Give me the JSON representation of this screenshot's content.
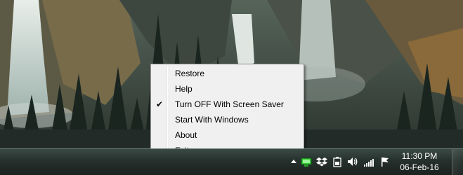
{
  "menu": {
    "items": [
      {
        "label": "Restore",
        "checked": false
      },
      {
        "label": "Help",
        "checked": false
      },
      {
        "label": "Turn OFF With Screen Saver",
        "checked": true
      },
      {
        "label": "Start With Windows",
        "checked": false
      },
      {
        "label": "About",
        "checked": false
      },
      {
        "label": "Exit",
        "checked": false
      }
    ],
    "check_glyph": "✔"
  },
  "taskbar": {
    "clock": {
      "time": "11:30 PM",
      "date": "06-Feb-16"
    },
    "tray_icons": [
      "show-hidden-icons-arrow-icon",
      "app-monitor-icon",
      "dropbox-icon",
      "battery-icon",
      "volume-icon",
      "network-signal-icon",
      "action-center-flag-icon"
    ]
  },
  "colors": {
    "menu_bg": "#f0f0f0",
    "taskbar": "#26302d",
    "app_icon_green": "#37c837"
  }
}
